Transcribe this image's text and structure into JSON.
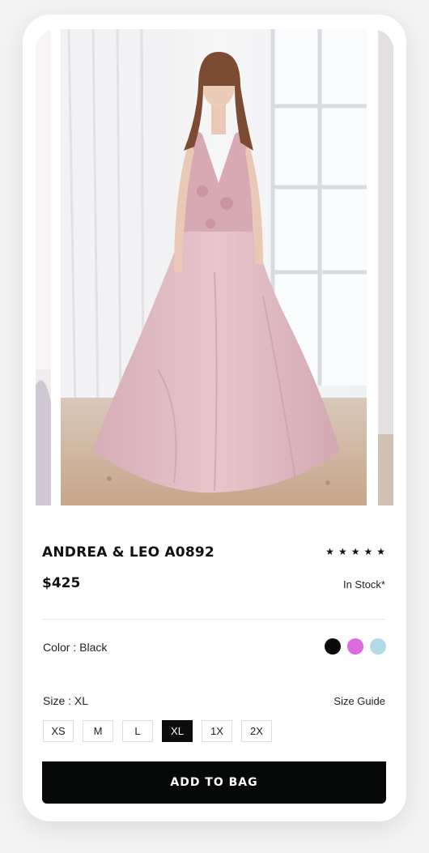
{
  "product": {
    "title": "ANDREA & LEO A0892",
    "rating_stars": 5,
    "price": "$425",
    "stock": "In Stock*"
  },
  "color": {
    "label": "Color : Black",
    "swatches": [
      {
        "name": "black",
        "hex": "#0a0a0a"
      },
      {
        "name": "orchid",
        "hex": "#dd6be0"
      },
      {
        "name": "light-blue",
        "hex": "#b1d9e6"
      }
    ]
  },
  "size": {
    "label": "Size : XL",
    "guide_label": "Size Guide",
    "options": [
      "XS",
      "M",
      "L",
      "XL",
      "1X",
      "2X"
    ],
    "selected": "XL"
  },
  "cta": {
    "add_label": "ADD TO BAG"
  },
  "icons": {
    "star": "star-icon"
  },
  "colors": {
    "button_bg": "#070909",
    "selected_size_bg": "#0b0c0c",
    "dress": "#dcb6bd"
  }
}
